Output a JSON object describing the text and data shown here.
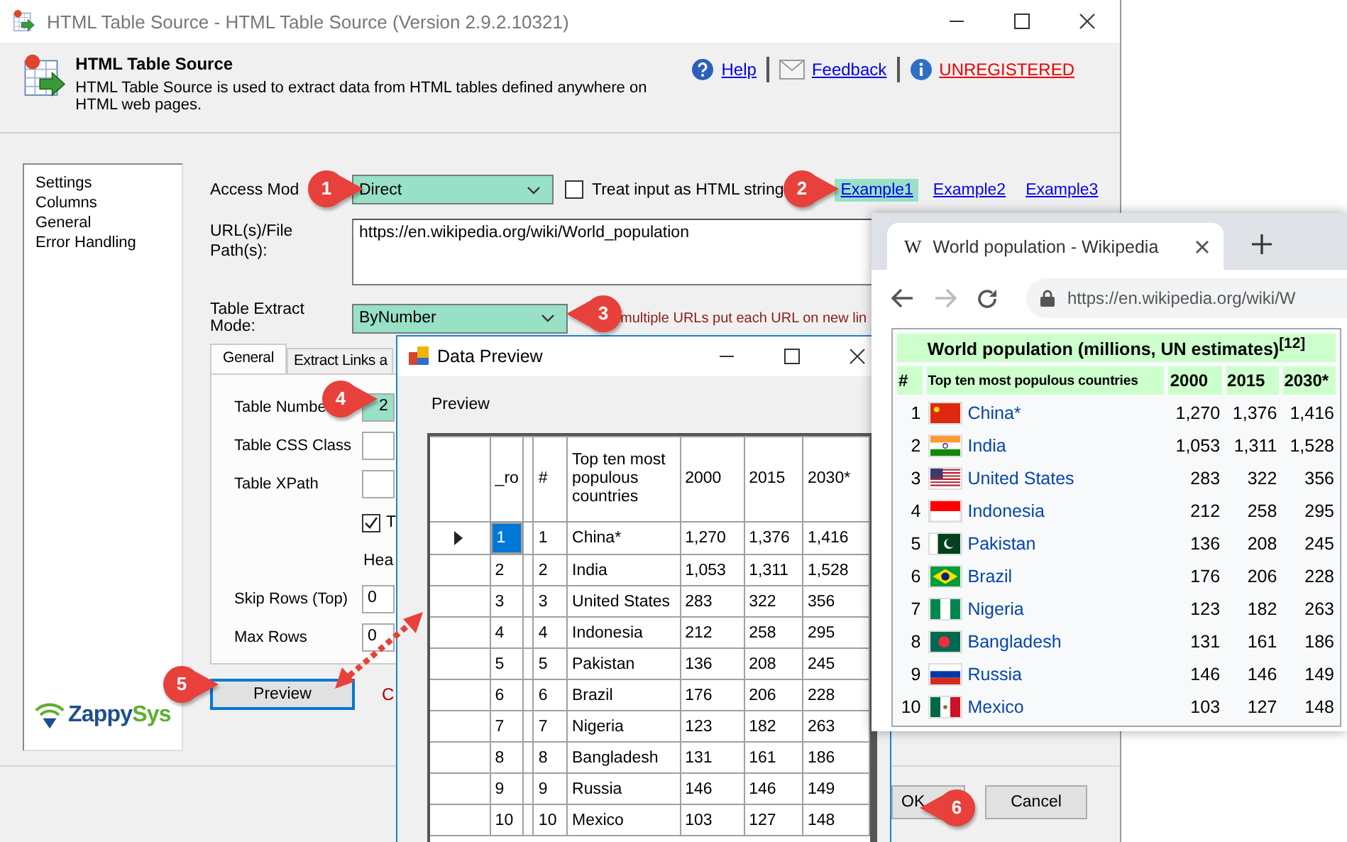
{
  "main_window": {
    "title": "HTML Table Source - HTML Table Source (Version 2.9.2.10321)"
  },
  "header": {
    "title": "HTML Table Source",
    "description": "HTML Table Source is used to extract data from HTML tables defined anywhere on HTML web pages.",
    "links": [
      {
        "kind": "help",
        "label": "Help"
      },
      {
        "kind": "feedback",
        "label": "Feedback"
      },
      {
        "kind": "info",
        "label": "UNREGISTERED"
      }
    ]
  },
  "sidebar": {
    "items": [
      "Settings",
      "Columns",
      "General",
      "Error Handling"
    ],
    "logo": [
      "Zappy",
      "Sys"
    ]
  },
  "access_mode": {
    "label": "Access Mod",
    "value": "Direct"
  },
  "html_string_checkbox": {
    "label": "Treat input as HTML string",
    "checked": false
  },
  "examples": [
    {
      "label": "Example1",
      "selected": true
    },
    {
      "label": "Example2",
      "selected": false
    },
    {
      "label": "Example3",
      "selected": false
    }
  ],
  "url": {
    "label": "URL(s)/File Path(s):",
    "value": "https://en.wikipedia.org/wiki/World_population"
  },
  "extract_mode": {
    "label": "Table Extract Mode:",
    "value": "ByNumber",
    "hint": "multiple URLs put each URL on new lin"
  },
  "tabs": [
    {
      "label": "General",
      "selected": true
    },
    {
      "label": "Extract Links a",
      "selected": false
    }
  ],
  "general": {
    "table_number": {
      "label": "Table Numbe",
      "value": "2"
    },
    "css_class": {
      "label": "Table CSS Class"
    },
    "xpath": {
      "label": "Table XPath"
    },
    "header_checkbox": {
      "label": "T",
      "checked": true
    },
    "header_text": "Hea",
    "skip_rows": {
      "label": "Skip Rows (Top)",
      "value": "0"
    },
    "max_rows": {
      "label": "Max Rows",
      "value": "0"
    }
  },
  "preview_button": "Preview",
  "preview_note": "C",
  "buttons": [
    "OK",
    "Cancel"
  ],
  "data_preview": {
    "title": "Data Preview",
    "label": "Preview",
    "columns": [
      "_ro",
      "#",
      "Top ten most populous countries",
      "2000",
      "2015",
      "2030*"
    ],
    "rows": [
      {
        "selected": true,
        "cells": [
          "1",
          "1",
          "China*",
          "1,270",
          "1,376",
          "1,416"
        ]
      },
      {
        "selected": false,
        "cells": [
          "2",
          "2",
          "India",
          "1,053",
          "1,311",
          "1,528"
        ]
      },
      {
        "selected": false,
        "cells": [
          "3",
          "3",
          "United States",
          "283",
          "322",
          "356"
        ]
      },
      {
        "selected": false,
        "cells": [
          "4",
          "4",
          "Indonesia",
          "212",
          "258",
          "295"
        ]
      },
      {
        "selected": false,
        "cells": [
          "5",
          "5",
          "Pakistan",
          "136",
          "208",
          "245"
        ]
      },
      {
        "selected": false,
        "cells": [
          "6",
          "6",
          "Brazil",
          "176",
          "206",
          "228"
        ]
      },
      {
        "selected": false,
        "cells": [
          "7",
          "7",
          "Nigeria",
          "123",
          "182",
          "263"
        ]
      },
      {
        "selected": false,
        "cells": [
          "8",
          "8",
          "Bangladesh",
          "131",
          "161",
          "186"
        ]
      },
      {
        "selected": false,
        "cells": [
          "9",
          "9",
          "Russia",
          "146",
          "146",
          "149"
        ]
      },
      {
        "selected": false,
        "cells": [
          "10",
          "10",
          "Mexico",
          "103",
          "127",
          "148"
        ]
      }
    ]
  },
  "browser": {
    "favicon": "W",
    "tab_title": "World population - Wikipedia",
    "address": "https://en.wikipedia.org/wiki/W",
    "table": {
      "caption": "World population (millions, UN estimates)$^{[12]}$",
      "columns": [
        "#",
        "Top ten most populous countries",
        "2000",
        "2015",
        "2030*"
      ],
      "rows": [
        [
          "1",
          "China*",
          "1,270",
          "1,376",
          "1,416"
        ],
        [
          "2",
          "India",
          "1,053",
          "1,311",
          "1,528"
        ],
        [
          "3",
          "United States",
          "283",
          "322",
          "356"
        ],
        [
          "4",
          "Indonesia",
          "212",
          "258",
          "295"
        ],
        [
          "5",
          "Pakistan",
          "136",
          "208",
          "245"
        ],
        [
          "6",
          "Brazil",
          "176",
          "206",
          "228"
        ],
        [
          "7",
          "Nigeria",
          "123",
          "182",
          "263"
        ],
        [
          "8",
          "Bangladesh",
          "131",
          "161",
          "186"
        ],
        [
          "9",
          "Russia",
          "146",
          "146",
          "149"
        ],
        [
          "10",
          "Mexico",
          "103",
          "127",
          "148"
        ]
      ]
    }
  },
  "callouts": [
    "1",
    "2",
    "3",
    "4",
    "5",
    "6"
  ]
}
